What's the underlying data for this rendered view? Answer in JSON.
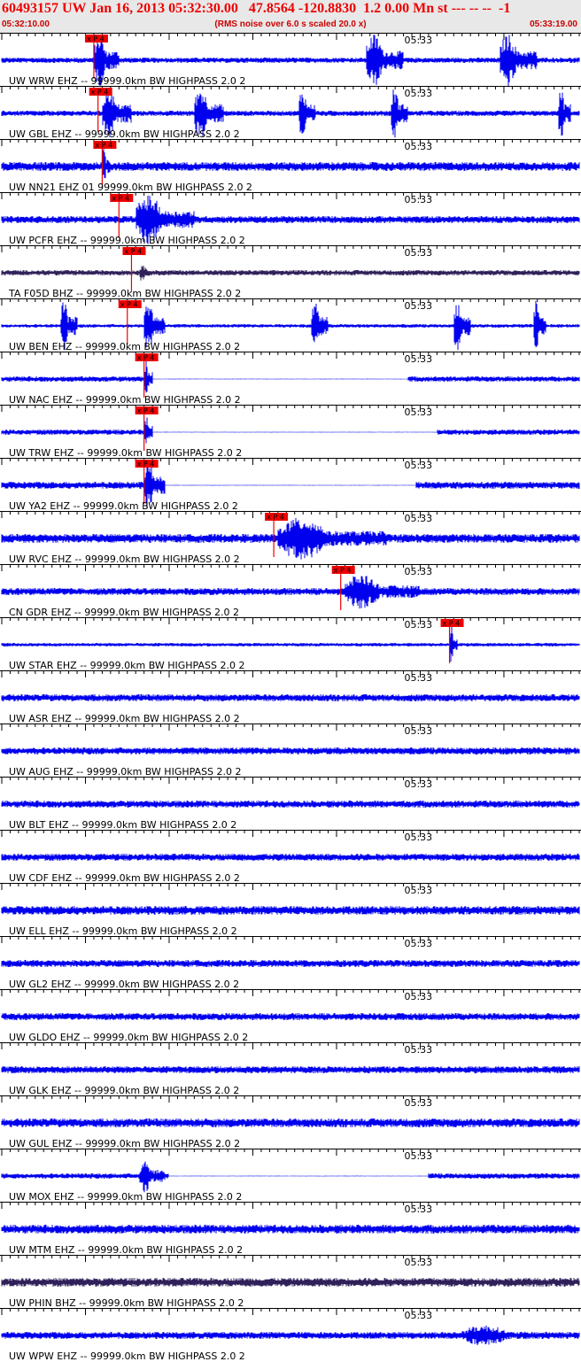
{
  "header": {
    "title": "60493157 UW Jan 16, 2013 05:32:30.00   47.8564 -120.8830  1.2 0.00 Mn st --- -- --  -1",
    "start_time": "05:32:10.00",
    "subtitle": "(RMS noise over 6.0 s scaled 20.0 x)",
    "end_time": "05:33:19.00"
  },
  "colors": {
    "title": "#ee0000",
    "header_bg": "#e8e8e8",
    "trace_blue": "#0000ee",
    "trace_dark": "#30205a",
    "pick_box": "#ee0000",
    "axis": "#000000"
  },
  "chart_data": {
    "type": "line",
    "x_unit": "time (UTC)",
    "time_range": [
      "05:32:10.00",
      "05:33:19.00"
    ],
    "minute_mark": "05:33",
    "pick_label": "x P 4",
    "traces": [
      {
        "label": "UW WRW EHZ -- 99999.0km BW  HIGHPASS  2.0  2",
        "pick": "05:32:21.0",
        "color": "blue",
        "noise": 3,
        "bursts": [
          {
            "t0": "05:32:21.0",
            "t1": "05:32:24.0",
            "amp": 30
          },
          {
            "t0": "05:32:53.5",
            "t1": "05:32:58.0",
            "amp": 30
          },
          {
            "t0": "05:33:09.5",
            "t1": "05:33:14.0",
            "amp": 30
          }
        ]
      },
      {
        "label": "UW GBL EHZ -- 99999.0km BW  HIGHPASS  2.0  2",
        "pick": "05:32:21.5",
        "color": "blue",
        "noise": 3,
        "bursts": [
          {
            "t0": "05:32:22.0",
            "t1": "05:32:25.5",
            "amp": 30
          },
          {
            "t0": "05:32:33.0",
            "t1": "05:32:36.5",
            "amp": 30
          },
          {
            "t0": "05:32:45.5",
            "t1": "05:32:47.5",
            "amp": 30
          },
          {
            "t0": "05:32:56.5",
            "t1": "05:32:58.5",
            "amp": 30
          },
          {
            "t0": "05:33:16.5",
            "t1": "05:33:18.0",
            "amp": 30
          }
        ]
      },
      {
        "label": "UW NN21 EHZ 01 99999.0km BW  HIGHPASS  2.0  2",
        "pick": "05:32:22.0",
        "color": "blue",
        "noise": 5,
        "bursts": [
          {
            "t0": "05:32:22.0",
            "t1": "05:32:23.0",
            "amp": 26
          }
        ]
      },
      {
        "label": "UW PCFR EHZ -- 99999.0km BW  HIGHPASS  2.0  2",
        "pick": "05:32:24.0",
        "color": "blue",
        "noise": 4,
        "bursts": [
          {
            "t0": "05:32:26.0",
            "t1": "05:32:33.0",
            "amp": 28
          }
        ]
      },
      {
        "label": "TA F05D BHZ -- 99999.0km BW  HIGHPASS  2.0  2",
        "pick": "05:32:25.5",
        "color": "dark",
        "noise": 3,
        "bursts": [
          {
            "t0": "05:32:26.5",
            "t1": "05:32:28.0",
            "amp": 12
          }
        ]
      },
      {
        "label": "UW BEN EHZ -- 99999.0km BW  HIGHPASS  2.0  2",
        "pick": "05:32:25.0",
        "color": "blue",
        "noise": 2,
        "bursts": [
          {
            "t0": "05:32:17.0",
            "t1": "05:32:19.0",
            "amp": 30
          },
          {
            "t0": "05:32:27.0",
            "t1": "05:32:29.5",
            "amp": 30
          },
          {
            "t0": "05:32:47.0",
            "t1": "05:32:49.0",
            "amp": 30
          },
          {
            "t0": "05:33:04.0",
            "t1": "05:33:06.0",
            "amp": 30
          },
          {
            "t0": "05:33:13.5",
            "t1": "05:33:15.0",
            "amp": 30
          }
        ]
      },
      {
        "label": "UW NAC EHZ -- 99999.0km BW  HIGHPASS  2.0  2",
        "pick": "05:32:27.0",
        "color": "blue",
        "noise": 3,
        "flat": [
          "05:32:28.0",
          "05:32:58.5"
        ],
        "bursts": [
          {
            "t0": "05:32:27.0",
            "t1": "05:32:28.0",
            "amp": 22
          }
        ]
      },
      {
        "label": "UW TRW EHZ -- 99999.0km BW  HIGHPASS  2.0  2",
        "pick": "05:32:27.0",
        "color": "blue",
        "noise": 3,
        "flat": [
          "05:32:28.0",
          "05:33:02.0"
        ],
        "bursts": [
          {
            "t0": "05:32:27.0",
            "t1": "05:32:28.0",
            "amp": 22
          }
        ]
      },
      {
        "label": "UW YA2 EHZ -- 99999.0km BW  HIGHPASS  2.0  2",
        "pick": "05:32:27.0",
        "color": "blue",
        "noise": 4,
        "flat": [
          "05:32:29.5",
          "05:32:59.5"
        ],
        "bursts": [
          {
            "t0": "05:32:27.0",
            "t1": "05:32:29.5",
            "amp": 28
          }
        ]
      },
      {
        "label": "UW RVC EHZ -- 99999.0km BW  HIGHPASS  2.0  2",
        "pick": "05:32:42.5",
        "color": "blue",
        "noise": 5,
        "bursts": [
          {
            "t0": "05:32:43.0",
            "t1": "05:32:56.0",
            "amp": 24
          }
        ]
      },
      {
        "label": "CN GDR EHZ -- 99999.0km BW  HIGHPASS  2.0  2",
        "pick": "05:32:50.5",
        "color": "blue",
        "noise": 4,
        "bursts": [
          {
            "t0": "05:32:51.0",
            "t1": "05:33:00.0",
            "amp": 20
          }
        ]
      },
      {
        "label": "UW STAR EHZ -- 99999.0km BW  HIGHPASS  2.0  2",
        "pick": "05:33:03.5",
        "color": "blue",
        "noise": 2,
        "bursts": [
          {
            "t0": "05:33:03.5",
            "t1": "05:33:04.5",
            "amp": 24
          }
        ]
      },
      {
        "label": "UW ASR EHZ -- 99999.0km BW  HIGHPASS  2.0  2",
        "pick": null,
        "color": "blue",
        "noise": 4,
        "bursts": []
      },
      {
        "label": "UW AUG EHZ -- 99999.0km BW  HIGHPASS  2.0  2",
        "pick": null,
        "color": "blue",
        "noise": 4,
        "bursts": []
      },
      {
        "label": "UW BLT EHZ -- 99999.0km BW  HIGHPASS  2.0  2",
        "pick": null,
        "color": "blue",
        "noise": 4,
        "bursts": []
      },
      {
        "label": "UW CDF EHZ -- 99999.0km BW  HIGHPASS  2.0  2",
        "pick": null,
        "color": "blue",
        "noise": 4,
        "bursts": []
      },
      {
        "label": "UW ELL EHZ -- 99999.0km BW  HIGHPASS  2.0  2",
        "pick": null,
        "color": "blue",
        "noise": 5,
        "bursts": []
      },
      {
        "label": "UW GL2 EHZ -- 99999.0km BW  HIGHPASS  2.0  2",
        "pick": null,
        "color": "blue",
        "noise": 4,
        "bursts": []
      },
      {
        "label": "UW GLDO EHZ -- 99999.0km BW  HIGHPASS  2.0  2",
        "pick": null,
        "color": "blue",
        "noise": 4,
        "bursts": []
      },
      {
        "label": "UW GLK EHZ -- 99999.0km BW  HIGHPASS  2.0  2",
        "pick": null,
        "color": "blue",
        "noise": 4,
        "bursts": []
      },
      {
        "label": "UW GUL EHZ -- 99999.0km BW  HIGHPASS  2.0  2",
        "pick": null,
        "color": "blue",
        "noise": 5,
        "bursts": []
      },
      {
        "label": "UW MOX EHZ -- 99999.0km BW  HIGHPASS  2.0  2",
        "pick": null,
        "color": "blue",
        "noise": 3,
        "flat": [
          "05:32:30.0",
          "05:33:01.0"
        ],
        "bursts": [
          {
            "t0": "05:32:26.5",
            "t1": "05:32:29.5",
            "amp": 20
          }
        ]
      },
      {
        "label": "UW MTM EHZ -- 99999.0km BW  HIGHPASS  2.0  2",
        "pick": null,
        "color": "blue",
        "noise": 5,
        "bursts": []
      },
      {
        "label": "UW PHIN BHZ -- 99999.0km BW  HIGHPASS  2.0  2",
        "pick": null,
        "color": "dark",
        "noise": 5,
        "bursts": []
      },
      {
        "label": "UW WPW EHZ -- 99999.0km BW  HIGHPASS  2.0  2",
        "pick": null,
        "color": "blue",
        "noise": 4,
        "bursts": [
          {
            "t0": "05:33:05.0",
            "t1": "05:33:17.0",
            "amp": 12
          }
        ]
      }
    ]
  }
}
